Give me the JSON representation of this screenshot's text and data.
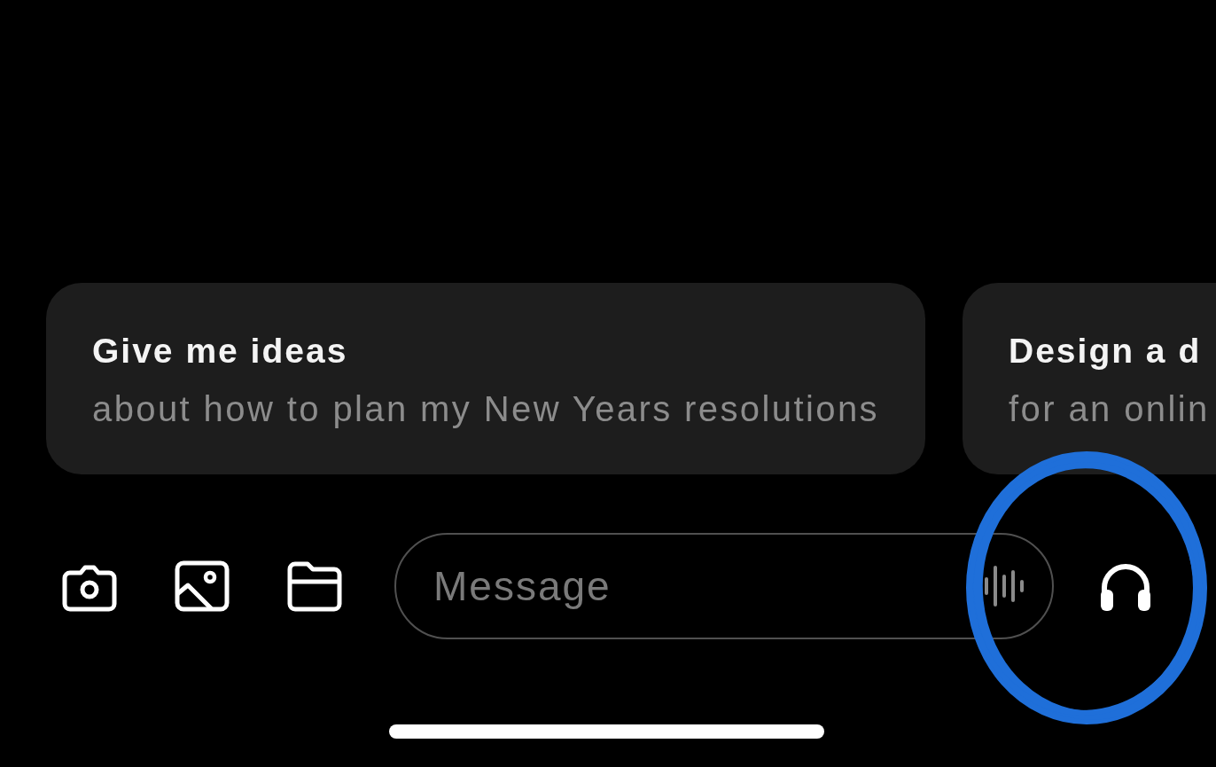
{
  "suggestions": [
    {
      "title": "Give me ideas",
      "subtitle": "about how to plan my New Years resolutions"
    },
    {
      "title": "Design a d",
      "subtitle": "for an onlin"
    }
  ],
  "composer": {
    "placeholder": "Message"
  }
}
